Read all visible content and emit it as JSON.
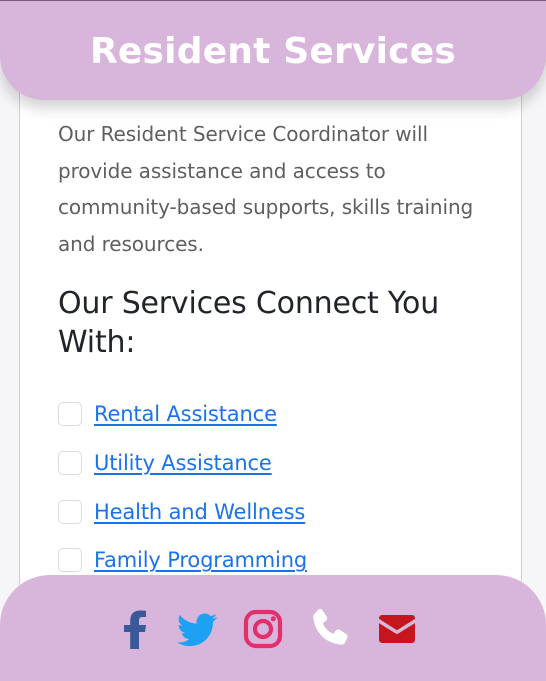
{
  "header": {
    "title": "Resident Services"
  },
  "intro": {
    "text": "Our Resident Service Coordinator will provide assistance and access to community-based supports, skills training and resources."
  },
  "services": {
    "heading": "Our Services Connect You With:",
    "items": [
      {
        "label": "Rental Assistance",
        "checked": false
      },
      {
        "label": "Utility Assistance",
        "checked": false
      },
      {
        "label": "Health and Wellness",
        "checked": false
      },
      {
        "label": "Family Programming",
        "checked": false
      }
    ]
  },
  "footer": {
    "social": [
      {
        "icon": "facebook-icon",
        "color": "#3b5998"
      },
      {
        "icon": "twitter-icon",
        "color": "#1da1f2"
      },
      {
        "icon": "instagram-icon",
        "color": "#e1306c"
      },
      {
        "icon": "phone-icon",
        "color": "#ffffff"
      },
      {
        "icon": "envelope-icon",
        "color": "#c4161c"
      }
    ]
  },
  "colors": {
    "accent": "#d8b6db",
    "link": "#1a73e8",
    "text_muted": "#5f5f5f"
  }
}
